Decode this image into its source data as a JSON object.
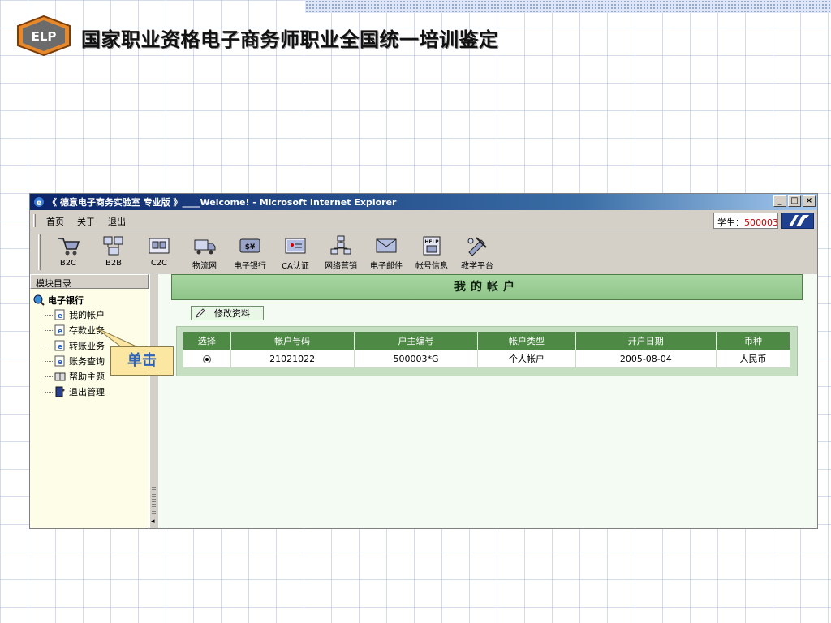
{
  "slide": {
    "title": "国家职业资格电子商务师职业全国统一培训鉴定",
    "logo_text": "ELP"
  },
  "window": {
    "title": "《 德意电子商务实验室 专业版 》____Welcome! - Microsoft Internet Explorer",
    "controls": {
      "minimize": "_",
      "maximize": "□",
      "close": "×"
    }
  },
  "menu": {
    "items": [
      "首页",
      "关于",
      "退出"
    ],
    "student_label": "学生：",
    "student_id": "500003"
  },
  "toolbar": {
    "items": [
      {
        "label": "B2C",
        "icon": "cart-icon"
      },
      {
        "label": "B2B",
        "icon": "network-icon"
      },
      {
        "label": "C2C",
        "icon": "c2c-icon"
      },
      {
        "label": "物流网",
        "icon": "truck-icon"
      },
      {
        "label": "电子银行",
        "icon": "bank-icon"
      },
      {
        "label": "CA认证",
        "icon": "certificate-icon"
      },
      {
        "label": "网络营销",
        "icon": "marketing-icon"
      },
      {
        "label": "电子邮件",
        "icon": "mail-icon"
      },
      {
        "label": "帐号信息",
        "icon": "help-icon"
      },
      {
        "label": "教学平台",
        "icon": "teaching-icon"
      }
    ]
  },
  "sidebar": {
    "header": "模块目录",
    "root": "电子银行",
    "items": [
      {
        "label": "我的帐户",
        "icon": "ie-page-icon"
      },
      {
        "label": "存款业务",
        "icon": "ie-page-icon"
      },
      {
        "label": "转账业务",
        "icon": "ie-page-icon"
      },
      {
        "label": "账务查询",
        "icon": "ie-page-icon"
      },
      {
        "label": "帮助主题",
        "icon": "help-book-icon"
      },
      {
        "label": "退出管理",
        "icon": "exit-icon"
      }
    ]
  },
  "content": {
    "title": "我的帐户",
    "edit_button": "修改资料",
    "table": {
      "headers": [
        "选择",
        "帐户号码",
        "户主编号",
        "帐户类型",
        "开户日期",
        "币种"
      ],
      "rows": [
        [
          "",
          "21021022",
          "500003*G",
          "个人帐户",
          "2005-08-04",
          "人民币"
        ]
      ]
    }
  },
  "callout": {
    "text": "单击"
  },
  "colors": {
    "header_green": "#4e8a45",
    "title_green": "#8fc589",
    "titlebar_blue": "#0a246a",
    "callout_bg": "#fbe7a1",
    "callout_text": "#2d63b8",
    "student_id": "#c00000"
  }
}
